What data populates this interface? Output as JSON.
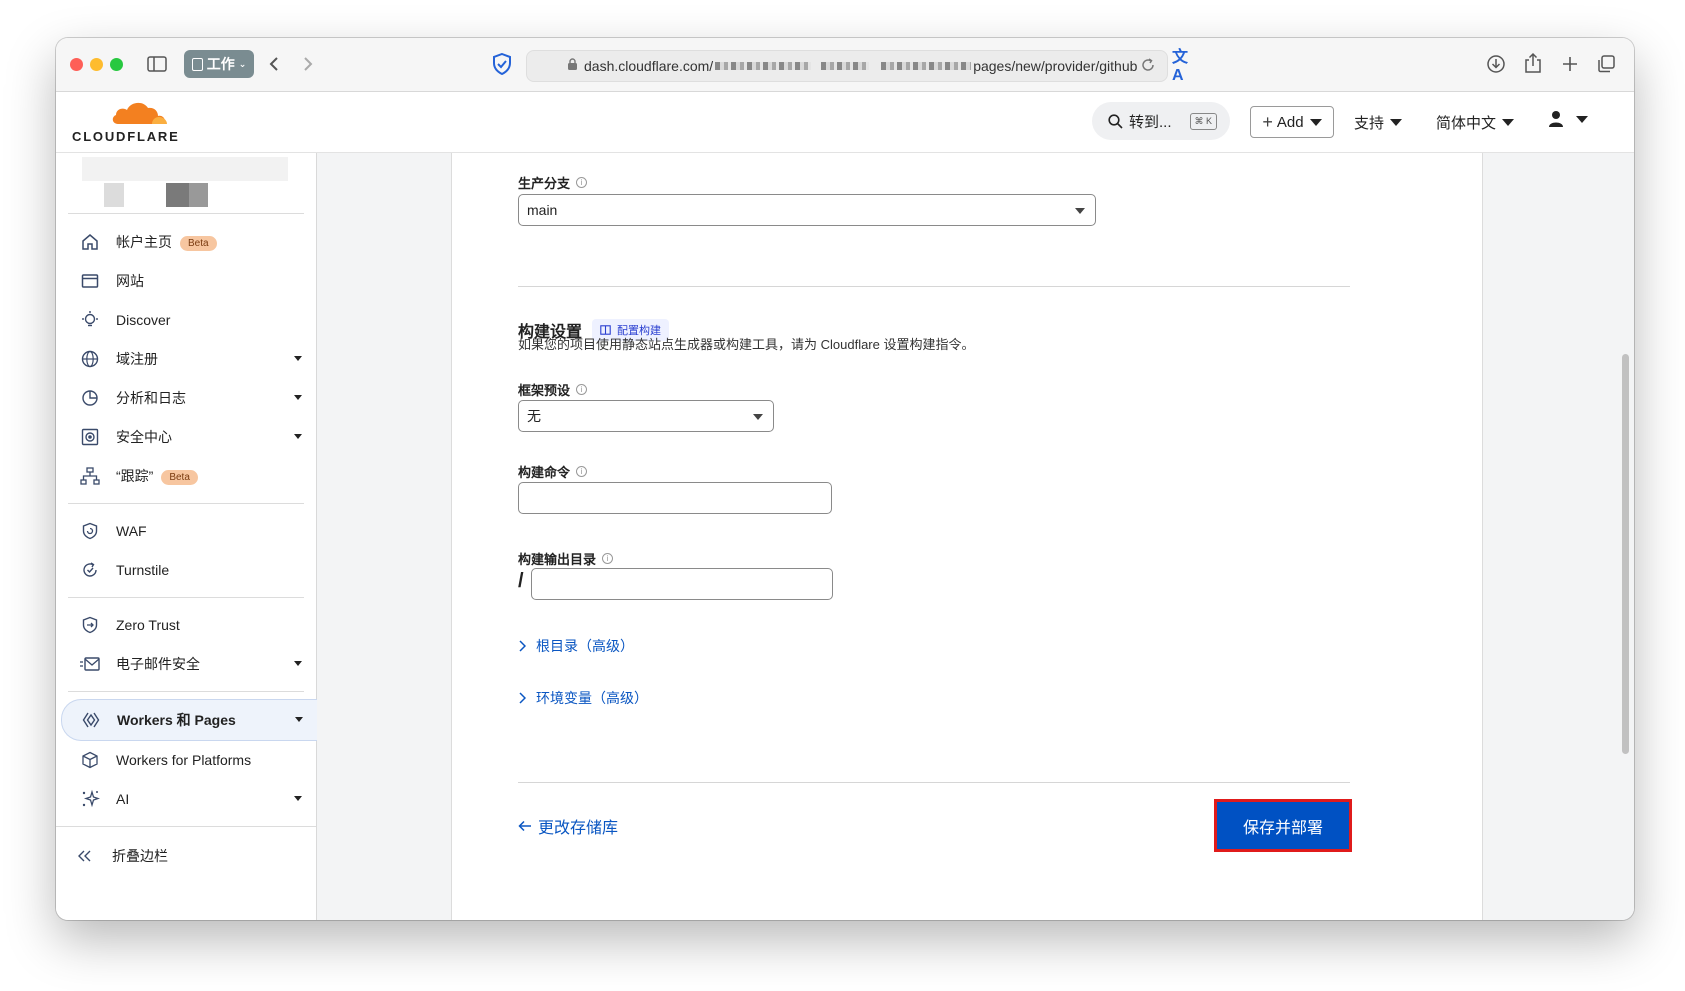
{
  "browser": {
    "tab_group": "工作",
    "url_host": "dash.cloudflare.com/",
    "url_path": "pages/new/provider/github"
  },
  "header": {
    "logo": "CLOUDFLARE",
    "goto_label": "转到...",
    "goto_shortcut": "⌘ K",
    "add_label": "Add",
    "support_label": "支持",
    "language_label": "简体中文"
  },
  "sidebar": {
    "items": [
      {
        "label": "帐户主页",
        "badge": "Beta"
      },
      {
        "label": "网站"
      },
      {
        "label": "Discover"
      },
      {
        "label": "域注册"
      },
      {
        "label": "分析和日志"
      },
      {
        "label": "安全中心"
      },
      {
        "label": "“跟踪”",
        "badge": "Beta"
      },
      {
        "label": "WAF"
      },
      {
        "label": "Turnstile"
      },
      {
        "label": "Zero Trust"
      },
      {
        "label": "电子邮件安全"
      },
      {
        "label": "Workers 和 Pages"
      },
      {
        "label": "Workers for Platforms"
      },
      {
        "label": "AI"
      }
    ],
    "collapse_label": "折叠边栏"
  },
  "form": {
    "branch_label": "生产分支",
    "branch_value": "main",
    "build_settings_title": "构建设置",
    "config_build_link": "配置构建",
    "build_desc": "如果您的项目使用静态站点生成器或构建工具，请为 Cloudflare 设置构建指令。",
    "framework_label": "框架预设",
    "framework_value": "无",
    "build_cmd_label": "构建命令",
    "build_cmd_value": "",
    "output_dir_label": "构建输出目录",
    "output_prefix": "/",
    "output_dir_value": "",
    "root_dir_toggle": "根目录（高级）",
    "env_vars_toggle": "环境变量（高级）",
    "change_repo_link": "更改存储库",
    "save_deploy_button": "保存并部署"
  },
  "colors": {
    "accent_blue": "#0051c3",
    "link_blue": "#0a56c2",
    "cloudflare_orange": "#f38020",
    "highlight_red": "#e01b1b"
  }
}
